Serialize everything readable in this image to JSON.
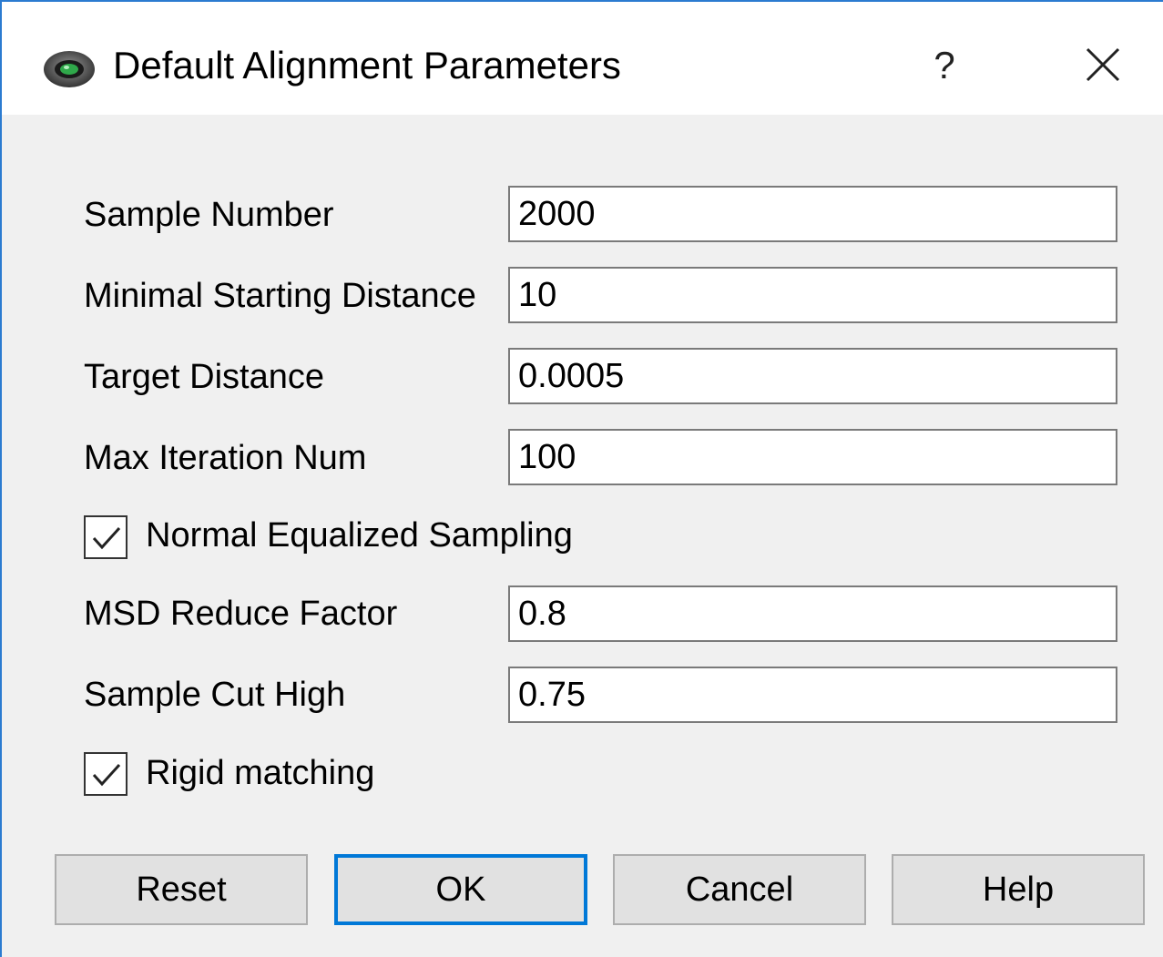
{
  "window": {
    "title": "Default Alignment Parameters",
    "help_glyph": "?",
    "icons": {
      "app": "app-eye-icon",
      "close": "close-icon"
    }
  },
  "fields": [
    {
      "label": "Sample Number",
      "value": "2000"
    },
    {
      "label": "Minimal Starting Distance",
      "value": "10"
    },
    {
      "label": "Target Distance",
      "value": "0.0005"
    },
    {
      "label": "Max Iteration Num",
      "value": "100"
    },
    {
      "label": "MSD Reduce Factor",
      "value": "0.8"
    },
    {
      "label": "Sample Cut High",
      "value": "0.75"
    }
  ],
  "checkboxes": [
    {
      "label": "Normal Equalized Sampling",
      "checked": true
    },
    {
      "label": "Rigid matching",
      "checked": true
    }
  ],
  "buttons": {
    "reset": "Reset",
    "ok": "OK",
    "cancel": "Cancel",
    "help": "Help"
  },
  "colors": {
    "window_border": "#2b7bd0",
    "default_button_border": "#0078d7",
    "background": "#f0f0f0"
  }
}
